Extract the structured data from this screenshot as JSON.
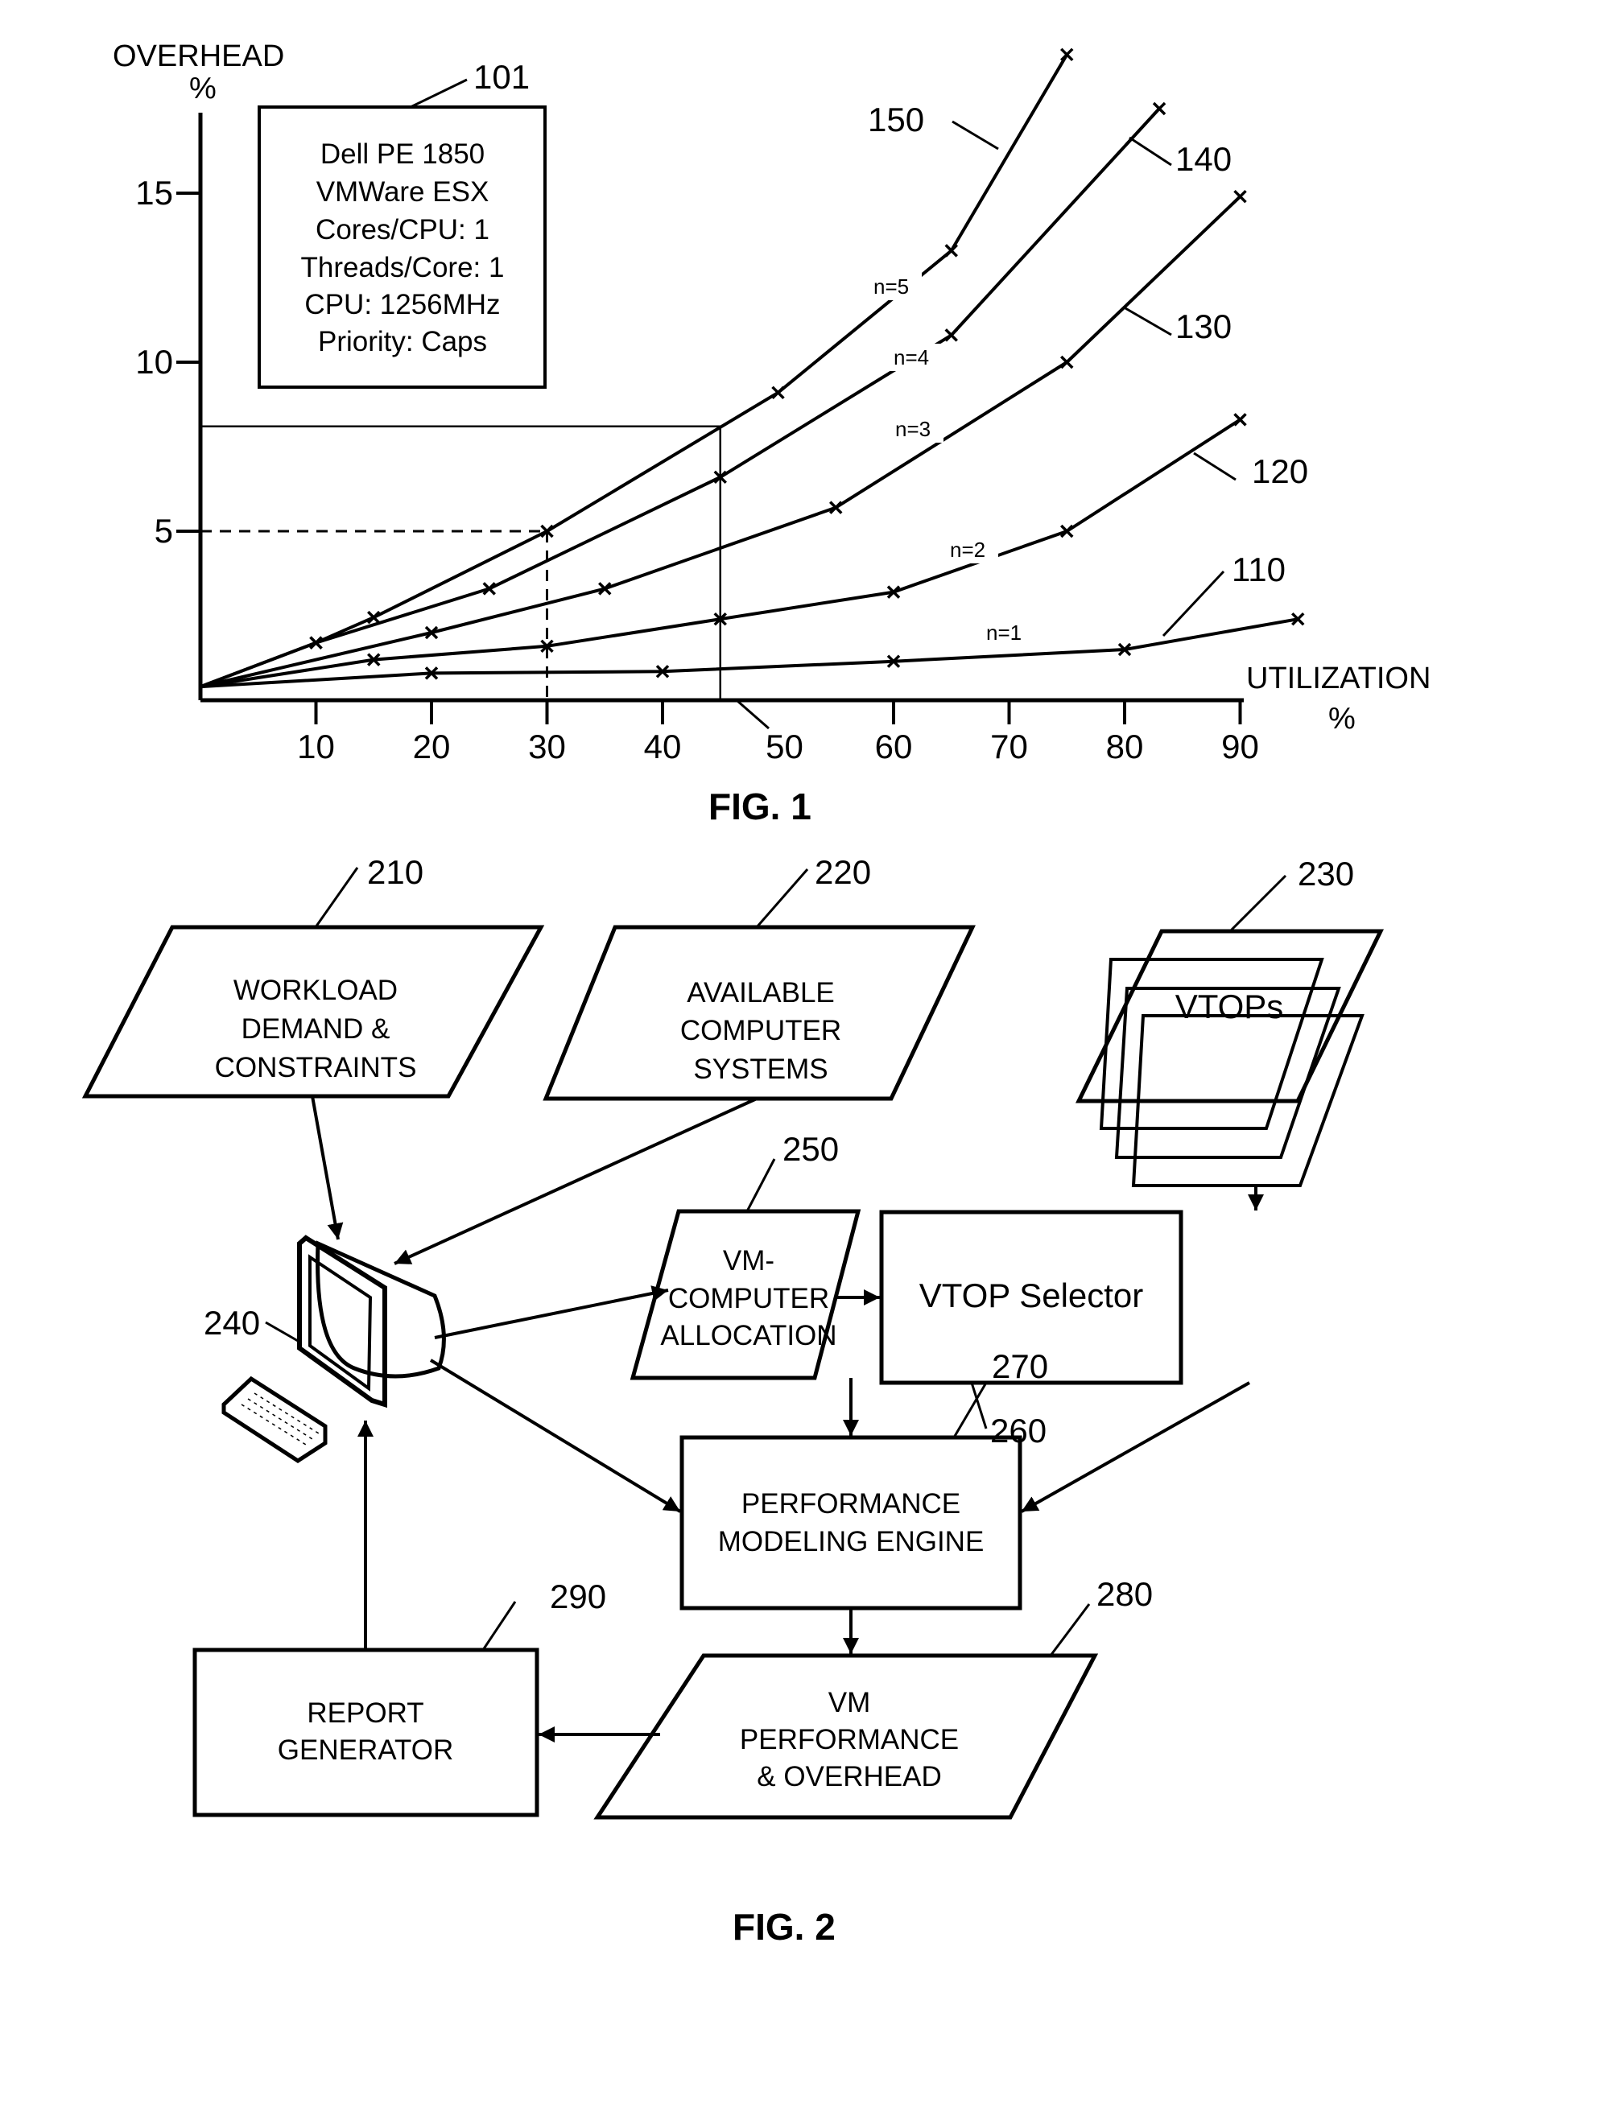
{
  "fig1": {
    "caption": "FIG. 1",
    "ref_box": {
      "ref": "101",
      "lines": [
        "Dell PE 1850",
        "VMWare ESX",
        "Cores/CPU: 1",
        "Threads/Core: 1",
        "CPU: 1256MHz",
        "Priority: Caps"
      ]
    },
    "axis_ref": "50"
  },
  "chart_data": {
    "type": "line",
    "title": "",
    "xlabel": [
      "UTILIZATION",
      "%"
    ],
    "ylabel": [
      "OVERHEAD",
      "%"
    ],
    "xlim": [
      0,
      95
    ],
    "ylim": [
      0,
      19
    ],
    "xticks": [
      10,
      20,
      30,
      40,
      50,
      60,
      70,
      80,
      90
    ],
    "xtick_labels": [
      "10",
      "20",
      "30",
      "40",
      "50",
      "60",
      "70",
      "80",
      "90"
    ],
    "yticks": [
      5,
      10,
      15
    ],
    "ytick_labels": [
      "5",
      "10",
      "15"
    ],
    "grid": false,
    "series": [
      {
        "name": "n=1",
        "ref": "110",
        "points": [
          [
            0,
            0.4
          ],
          [
            20,
            0.8
          ],
          [
            40,
            0.85
          ],
          [
            60,
            1.15
          ],
          [
            80,
            1.5
          ],
          [
            95,
            2.4
          ]
        ]
      },
      {
        "name": "n=2",
        "ref": "120",
        "points": [
          [
            0,
            0.4
          ],
          [
            15,
            1.2
          ],
          [
            30,
            1.6
          ],
          [
            45,
            2.4
          ],
          [
            60,
            3.2
          ],
          [
            75,
            5.0
          ],
          [
            90,
            8.3
          ]
        ]
      },
      {
        "name": "n=3",
        "ref": "130",
        "points": [
          [
            0,
            0.4
          ],
          [
            20,
            2.0
          ],
          [
            35,
            3.3
          ],
          [
            55,
            5.7
          ],
          [
            75,
            10.0
          ],
          [
            90,
            14.9
          ]
        ]
      },
      {
        "name": "n=4",
        "ref": "140",
        "points": [
          [
            0,
            0.4
          ],
          [
            10,
            1.7
          ],
          [
            25,
            3.3
          ],
          [
            45,
            6.6
          ],
          [
            65,
            10.8
          ],
          [
            83,
            17.5
          ]
        ]
      },
      {
        "name": "n=5",
        "ref": "150",
        "points": [
          [
            0,
            0.4
          ],
          [
            10,
            1.7
          ],
          [
            15,
            2.45
          ],
          [
            30,
            5.0
          ],
          [
            50,
            9.1
          ],
          [
            65,
            13.3
          ],
          [
            75,
            19.1
          ]
        ]
      }
    ],
    "annotations": [
      {
        "type": "dashed-guide",
        "x": 30,
        "y": 5
      },
      {
        "type": "solid-guide",
        "x": 45,
        "y": 8.1
      }
    ]
  },
  "fig2": {
    "caption": "FIG. 2",
    "nodes": {
      "workload": {
        "ref": "210",
        "lines": [
          "WORKLOAD",
          "DEMAND &",
          "CONSTRAINTS"
        ]
      },
      "available": {
        "ref": "220",
        "lines": [
          "AVAILABLE",
          "COMPUTER",
          "SYSTEMS"
        ]
      },
      "vtops": {
        "ref": "230",
        "lines": [
          "VTOPs"
        ]
      },
      "computer": {
        "ref": "240"
      },
      "allocation": {
        "ref": "250",
        "lines": [
          "VM-",
          "COMPUTER",
          "ALLOCATION"
        ]
      },
      "selector": {
        "ref": "260",
        "lines": [
          "VTOP Selector"
        ]
      },
      "engine": {
        "ref": "270",
        "lines": [
          "PERFORMANCE",
          "MODELING ENGINE"
        ]
      },
      "overhead": {
        "ref": "280",
        "lines": [
          "VM",
          "PERFORMANCE",
          "& OVERHEAD"
        ]
      },
      "report": {
        "ref": "290",
        "lines": [
          "REPORT",
          "GENERATOR"
        ]
      }
    }
  }
}
